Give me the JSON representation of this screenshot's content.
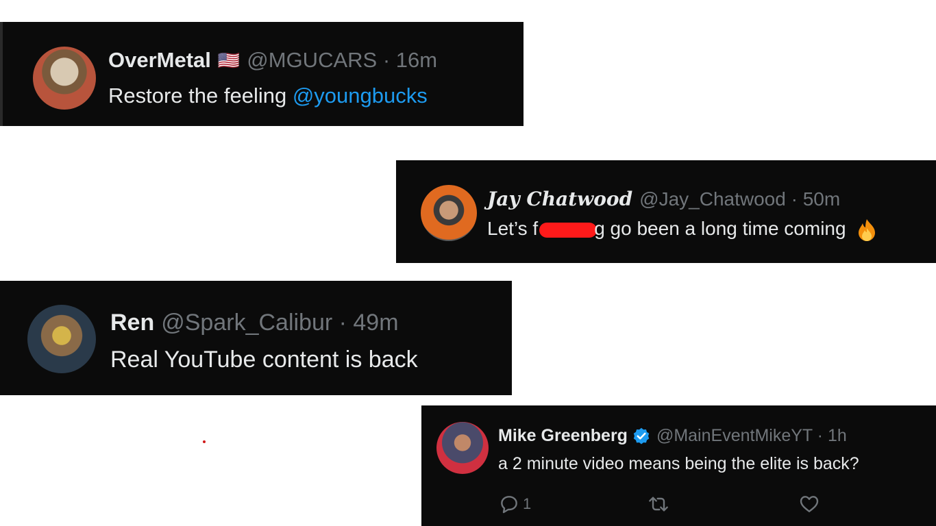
{
  "tweets": [
    {
      "name": "OverMetal",
      "flag": "🇺🇸",
      "handle_time": "@MGUCARS · 16m",
      "text": "Restore the feeling ",
      "mention": "@youngbucks"
    },
    {
      "name": "Jay Chatwood",
      "handle_time": "@Jay_Chatwood · 50m",
      "text_before": "Let’s f",
      "text_after": "g go been a long time coming"
    },
    {
      "name": "Ren",
      "handle_time": "@Spark_Calibur · 49m",
      "text": "Real YouTube content is back"
    },
    {
      "name": "Mike Greenberg",
      "handle_time": "@MainEventMikeYT · 1h",
      "text": "a 2 minute video means being the elite is back?",
      "reply_count": "1"
    }
  ],
  "colors": {
    "card_bg": "#0b0b0b",
    "text": "#e7e9ea",
    "muted": "#71767b",
    "link": "#1d9bf0",
    "verified": "#1d9bf0",
    "redaction": "#ff1a1a"
  }
}
